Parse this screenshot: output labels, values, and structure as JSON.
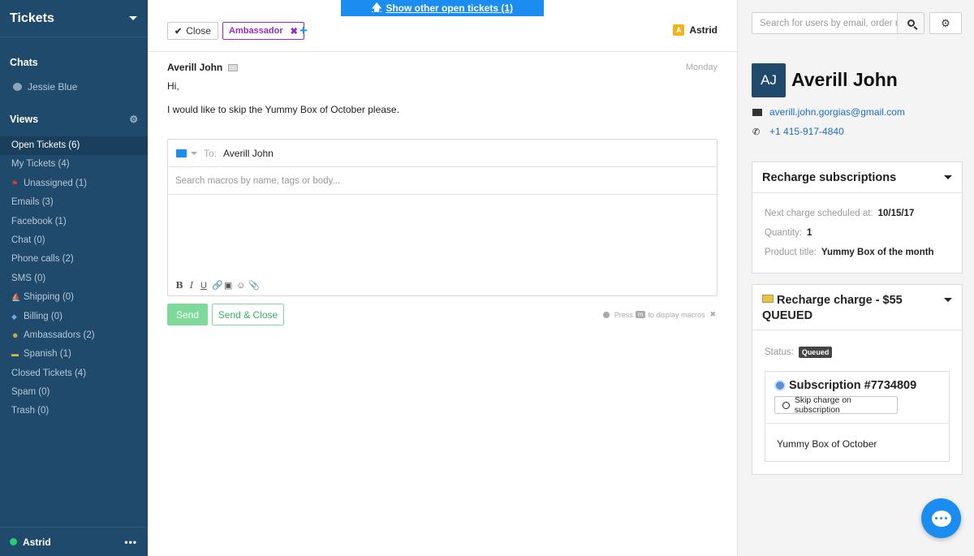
{
  "sidebar": {
    "title": "Tickets",
    "chats_label": "Chats",
    "chat_user": "Jessie Blue",
    "views_label": "Views",
    "views": [
      {
        "label": "Open Tickets (6)",
        "icon": "",
        "active": true
      },
      {
        "label": "My Tickets (4)",
        "icon": ""
      },
      {
        "label": "Unassigned (1)",
        "icon": "flag-icon"
      },
      {
        "label": "Emails (3)",
        "icon": ""
      },
      {
        "label": "Facebook (1)",
        "icon": ""
      },
      {
        "label": "Chat (0)",
        "icon": ""
      },
      {
        "label": "Phone calls (2)",
        "icon": ""
      },
      {
        "label": "SMS (0)",
        "icon": ""
      },
      {
        "label": "Shipping (0)",
        "icon": "ship-icon"
      },
      {
        "label": "Billing (0)",
        "icon": "diamond-icon"
      },
      {
        "label": "Ambassadors (2)",
        "icon": "people-icon"
      },
      {
        "label": "Spanish (1)",
        "icon": "speech-icon"
      },
      {
        "label": "Closed Tickets (4)",
        "icon": ""
      },
      {
        "label": "Spam (0)",
        "icon": ""
      },
      {
        "label": "Trash (0)",
        "icon": ""
      }
    ],
    "footer_user": "Astrid",
    "footer_more": "•••"
  },
  "banner": {
    "label": "Show other open tickets (1)"
  },
  "toolbar": {
    "close_label": "Close",
    "tag_label": "Ambassador",
    "tag_remove": "✖",
    "add_tag": "+",
    "assignee_initial": "A",
    "assignee": "Astrid"
  },
  "message": {
    "author": "Averill John",
    "date": "Monday",
    "lines": [
      "Hi,",
      "I would like to skip the Yummy Box of October please."
    ]
  },
  "reply": {
    "to_label": "To:",
    "to_name": "Averill John",
    "macro_placeholder": "Search macros by name, tags or body...",
    "format_icons": [
      "B",
      "I",
      "U",
      "🔗",
      "▣",
      "☺",
      "📎"
    ],
    "send_label": "Send",
    "send_close_label": "Send & Close",
    "hint_press": "Press",
    "hint_key": "m",
    "hint_rest": "to display macros",
    "hint_close": "✖"
  },
  "customer_panel": {
    "search_placeholder": "Search for users by email, order n",
    "avatar_initials": "AJ",
    "name": "Averill John",
    "email": "averill.john.gorgias@gmail.com",
    "phone": "+1 415-917-4840"
  },
  "subscriptions_card": {
    "title": "Recharge subscriptions",
    "next_charge_label": "Next charge scheduled at:",
    "next_charge_value": "10/15/17",
    "quantity_label": "Quantity:",
    "quantity_value": "1",
    "product_label": "Product title:",
    "product_value": "Yummy Box of the month"
  },
  "charge_card": {
    "title_line1": "Recharge charge - $55",
    "title_line2": "QUEUED",
    "status_label": "Status:",
    "status_value": "Queued",
    "subscription_title": "Subscription #7734809",
    "skip_label": "Skip charge on subscription",
    "product": "Yummy Box of October"
  },
  "colors": {
    "sidebar_bg": "#1f4a6b",
    "accent": "#1b8cf0",
    "tag": "#9b2bc0",
    "send": "#7fd99b"
  }
}
